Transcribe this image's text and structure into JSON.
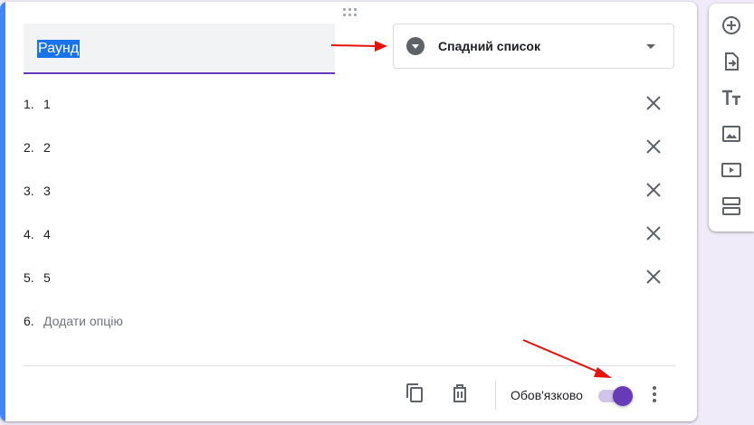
{
  "question": {
    "title_value": "Раунд",
    "type_label": "Спадний список",
    "type_icon": "dropdown-circle-icon",
    "options": [
      {
        "num": "1.",
        "text": "1"
      },
      {
        "num": "2.",
        "text": "2"
      },
      {
        "num": "3.",
        "text": "3"
      },
      {
        "num": "4.",
        "text": "4"
      },
      {
        "num": "5.",
        "text": "5"
      }
    ],
    "add_option": {
      "num": "6.",
      "text": "Додати опцію"
    }
  },
  "footer": {
    "duplicate_icon": "copy-icon",
    "delete_icon": "trash-icon",
    "required_label": "Обов'язково",
    "required_on": true,
    "more_icon": "more-vert-icon"
  },
  "side_toolbar": {
    "items": [
      "add-question-icon",
      "import-questions-icon",
      "add-title-icon",
      "add-image-icon",
      "add-video-icon",
      "add-section-icon"
    ]
  },
  "colors": {
    "accent": "#673ab7",
    "card_accent": "#4285f4",
    "annotation_arrow": "#e3120b",
    "selection": "#1a73e8"
  }
}
